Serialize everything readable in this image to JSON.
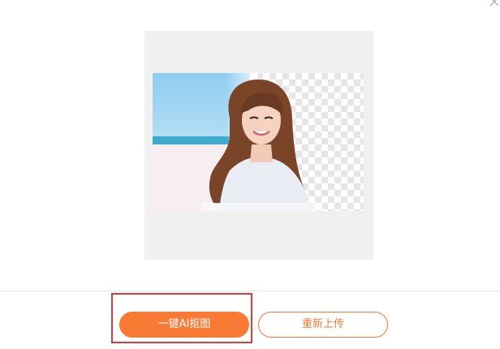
{
  "dialog": {
    "close_icon": "close-icon",
    "preview": {
      "image_description_icon": "portrait-photo"
    },
    "actions": {
      "primary_label": "一键AI抠图",
      "secondary_label": "重新上传"
    }
  },
  "colors": {
    "accent": "#f87a35",
    "highlight": "#e03a3a",
    "panel_bg": "#f0f0f0"
  }
}
